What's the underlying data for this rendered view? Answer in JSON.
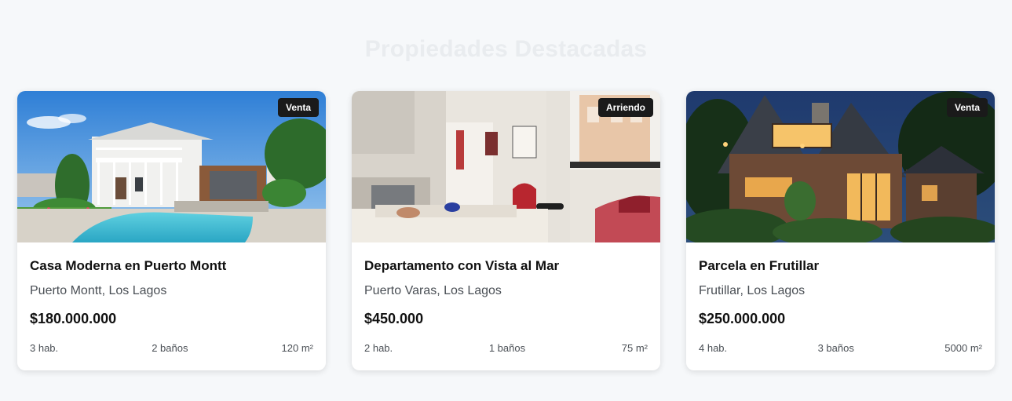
{
  "section": {
    "title": "Propiedades Destacadas"
  },
  "properties": [
    {
      "badge": "Venta",
      "title": "Casa Moderna en Puerto Montt",
      "location": "Puerto Montt, Los Lagos",
      "price": "$180.000.000",
      "bedrooms": "3 hab.",
      "bathrooms": "2 baños",
      "area": "120 m²"
    },
    {
      "badge": "Arriendo",
      "title": "Departamento con Vista al Mar",
      "location": "Puerto Varas, Los Lagos",
      "price": "$450.000",
      "bedrooms": "2 hab.",
      "bathrooms": "1 baños",
      "area": "75 m²"
    },
    {
      "badge": "Venta",
      "title": "Parcela en Frutillar",
      "location": "Frutillar, Los Lagos",
      "price": "$250.000.000",
      "bedrooms": "4 hab.",
      "bathrooms": "3 baños",
      "area": "5000 m²"
    }
  ]
}
